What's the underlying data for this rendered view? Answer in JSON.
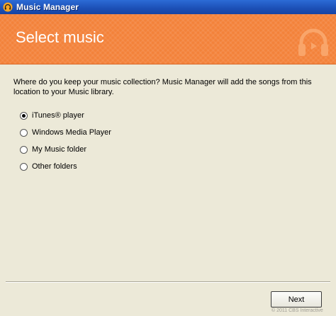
{
  "window": {
    "title": "Music Manager"
  },
  "banner": {
    "heading": "Select music",
    "logo_icon": "headphones-icon",
    "color": "#f3823a"
  },
  "content": {
    "prompt": "Where do you keep your music collection? Music Manager will add the songs from this location to your Music library.",
    "options": [
      {
        "label": "iTunes® player",
        "selected": true
      },
      {
        "label": "Windows Media Player",
        "selected": false
      },
      {
        "label": "My Music folder",
        "selected": false
      },
      {
        "label": "Other folders",
        "selected": false
      }
    ]
  },
  "footer": {
    "next_label": "Next",
    "note": "© 2011 CBS Interactive"
  }
}
